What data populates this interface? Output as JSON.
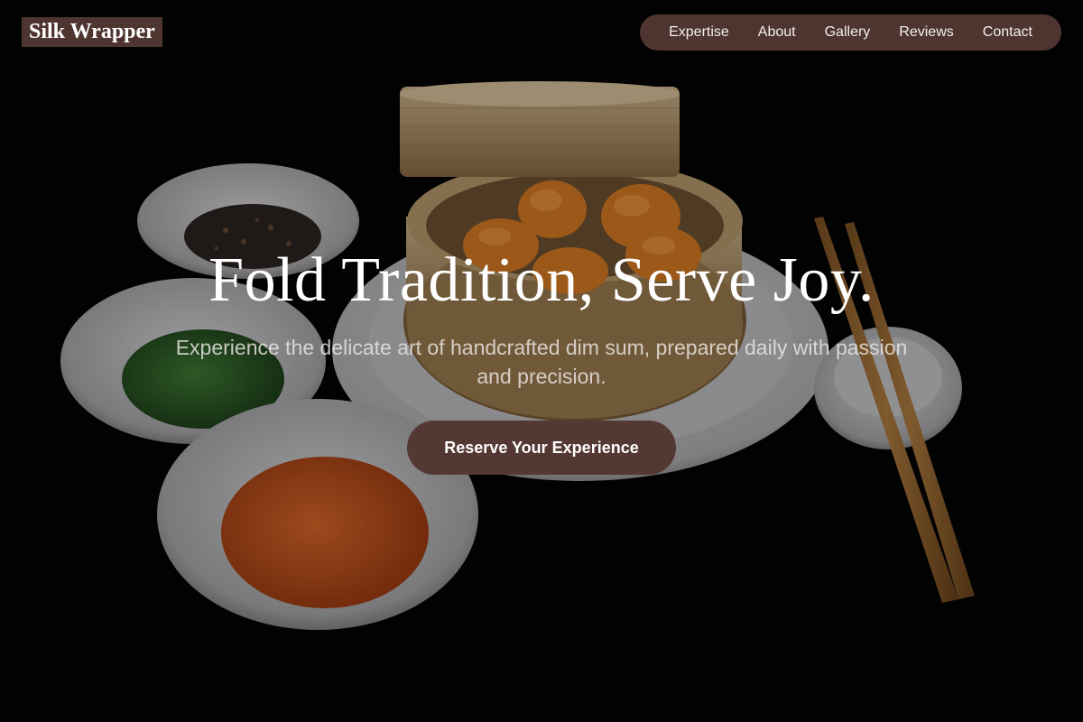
{
  "brand": {
    "name": "Silk Wrapper"
  },
  "nav": {
    "items": [
      {
        "label": "Expertise"
      },
      {
        "label": "About"
      },
      {
        "label": "Gallery"
      },
      {
        "label": "Reviews"
      },
      {
        "label": "Contact"
      }
    ]
  },
  "hero": {
    "headline": "Fold Tradition, Serve Joy.",
    "subheadline": "Experience the delicate art of handcrafted dim sum, prepared daily with passion and precision.",
    "cta_label": "Reserve Your Experience",
    "image": "dim-sum-bamboo-steamer-with-sauces-and-chopsticks"
  },
  "colors": {
    "accent": "#4e3530",
    "button": "#543833",
    "background": "#000000",
    "text": "#ffffff"
  }
}
